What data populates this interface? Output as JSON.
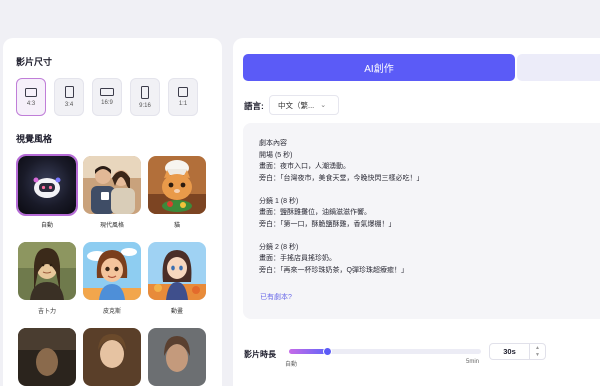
{
  "video_size": {
    "title": "影片尺寸",
    "ratios": [
      {
        "label": "4:3",
        "selected": true
      },
      {
        "label": "3:4",
        "selected": false
      },
      {
        "label": "16:9",
        "selected": false
      },
      {
        "label": "9:16",
        "selected": false
      },
      {
        "label": "1:1",
        "selected": false
      }
    ]
  },
  "visual_style": {
    "title": "視覺風格",
    "styles": [
      {
        "label": "自動",
        "selected": true
      },
      {
        "label": "現代風格",
        "selected": false
      },
      {
        "label": "貓",
        "selected": false
      },
      {
        "label": "吉卜力",
        "selected": false
      },
      {
        "label": "皮克斯",
        "selected": false
      },
      {
        "label": "動畫",
        "selected": false
      },
      {
        "label": "",
        "selected": false
      },
      {
        "label": "",
        "selected": false
      },
      {
        "label": "",
        "selected": false
      }
    ]
  },
  "tabs": {
    "ai_create": "AI創作"
  },
  "language": {
    "label": "語言:",
    "value": "中文（繁..."
  },
  "script": {
    "lines": [
      "劇本內容",
      "開場 (5 秒)",
      "畫面：夜市入口，人潮湧動。",
      "旁白：「台灣夜市，美食天堂，今晚快閃三樣必吃！」",
      "",
      "分鏡 1 (8 秒)",
      "畫面：鹽酥雞攤位，油鍋滋滋作響。",
      "旁白：「第一口，酥脆鹽酥雞，香氣爆棚！」",
      "",
      "分鏡 2 (8 秒)",
      "畫面：手搖店員搖珍奶。",
      "旁白：「再來一杯珍珠奶茶，Q彈珍珠超療癒！」"
    ],
    "have_script_link": "已有劇本?"
  },
  "duration": {
    "label": "影片時長",
    "min_label": "自動",
    "max_label": "5min",
    "value_label": "30s",
    "slider_fraction": 0.2
  },
  "colors": {
    "accent": "#5b5bf7",
    "selected_border": "#b56bd6"
  }
}
